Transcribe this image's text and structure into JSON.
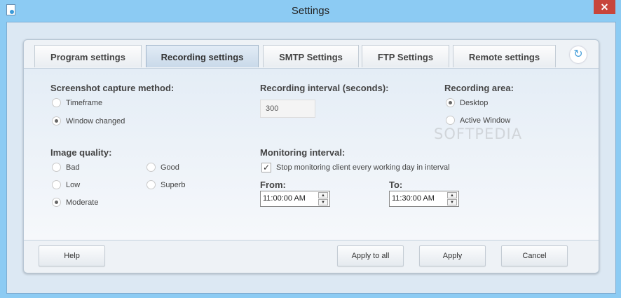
{
  "window": {
    "title": "Settings",
    "close_glyph": "✕"
  },
  "tabs": [
    {
      "label": "Program settings",
      "active": false
    },
    {
      "label": "Recording settings",
      "active": true
    },
    {
      "label": "SMTP Settings",
      "active": false
    },
    {
      "label": "FTP Settings",
      "active": false
    },
    {
      "label": "Remote settings",
      "active": false
    }
  ],
  "capture": {
    "title": "Screenshot capture method:",
    "options": [
      {
        "label": "Timeframe",
        "selected": false
      },
      {
        "label": "Window changed",
        "selected": true
      }
    ]
  },
  "interval": {
    "title": "Recording interval (seconds):",
    "value": "300"
  },
  "area": {
    "title": "Recording area:",
    "options": [
      {
        "label": "Desktop",
        "selected": true
      },
      {
        "label": "Active Window",
        "selected": false
      }
    ]
  },
  "quality": {
    "title": "Image quality:",
    "options": [
      {
        "label": "Bad",
        "selected": false
      },
      {
        "label": "Good",
        "selected": false
      },
      {
        "label": "Low",
        "selected": false
      },
      {
        "label": "Superb",
        "selected": false
      },
      {
        "label": "Moderate",
        "selected": true
      }
    ]
  },
  "monitoring": {
    "title": "Monitoring interval:",
    "checkbox_label": "Stop monitoring client  every working day in interval",
    "checked": true,
    "from_label": "From:",
    "from_value": "11:00:00 AM",
    "to_label": "To:",
    "to_value": "11:30:00 AM"
  },
  "buttons": {
    "help": "Help",
    "apply_all": "Apply to all",
    "apply": "Apply",
    "cancel": "Cancel"
  },
  "watermark": "SOFTPEDIA",
  "colors": {
    "title_bar": "#8ccbf3",
    "close_button": "#c7463c",
    "active_tab": "#c9d9e9"
  }
}
